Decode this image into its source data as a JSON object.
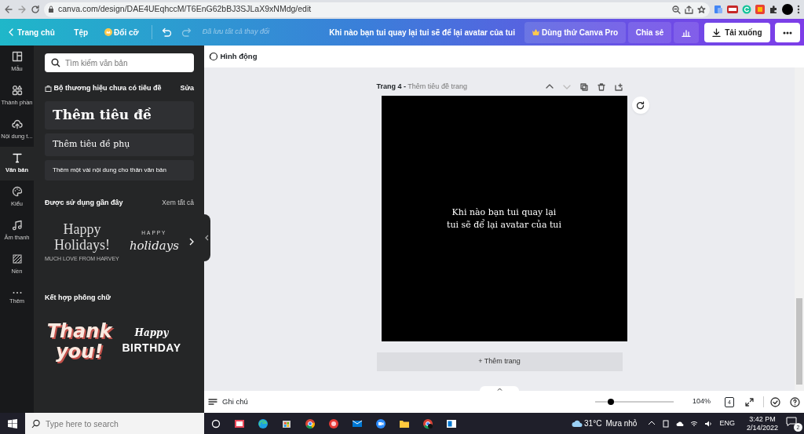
{
  "browser": {
    "url": "canva.com/design/DAE4UEqhccM/T6EnG62bBJ3SJLaX9xNMdg/edit"
  },
  "toolbar": {
    "home": "Trang chủ",
    "file": "Tệp",
    "resize": "Đổi cỡ",
    "saved_status": "Đã lưu tất cả thay đổi",
    "design_title": "Khi nào bạn tui quay lại tui sẽ để lại avatar của tui",
    "pro_button": "Dùng thử Canva Pro",
    "share_button": "Chia sẻ",
    "download_button": "Tải xuống"
  },
  "rail": {
    "items": [
      {
        "kind": "template",
        "label": "Mẫu",
        "selected": false
      },
      {
        "kind": "elements",
        "label": "Thành phần",
        "selected": false
      },
      {
        "kind": "upload",
        "label": "Nội dung t...",
        "selected": false
      },
      {
        "kind": "text",
        "label": "Văn bản",
        "selected": true
      },
      {
        "kind": "style",
        "label": "Kiểu",
        "selected": false
      },
      {
        "kind": "audio",
        "label": "Âm thanh",
        "selected": false
      },
      {
        "kind": "background",
        "label": "Nền",
        "selected": false
      },
      {
        "kind": "more",
        "label": "Thêm",
        "selected": false
      }
    ]
  },
  "panel": {
    "search": {
      "placeholder": "Tìm kiếm văn bản"
    },
    "brand_kit": {
      "title": "Bộ thương hiệu chưa có tiêu đề",
      "edit": "Sửa"
    },
    "text_styles": [
      {
        "kind": "heading",
        "label": "Thêm tiêu đề"
      },
      {
        "kind": "subheading",
        "label": "Thêm tiêu đề phụ"
      },
      {
        "kind": "body",
        "label": "Thêm một vài nội dung cho thân văn bản"
      }
    ],
    "recent": {
      "title": "Được sử dụng gần đây",
      "see_all": "Xem tất cả",
      "templates": [
        {
          "kind": "serif",
          "lines": [
            "Happy",
            "Holidays!",
            "MUCH LOVE FROM HARVEY"
          ]
        },
        {
          "kind": "script",
          "lines": [
            "HAPPY",
            "holidays"
          ]
        }
      ]
    },
    "font_combos": {
      "title": "Kết hợp phông chữ",
      "templates": [
        {
          "kind": "thank",
          "lines": [
            "Thank",
            "you!"
          ]
        },
        {
          "kind": "birthday",
          "lines": [
            "Happy",
            "BIRTHDAY"
          ]
        }
      ]
    }
  },
  "editor": {
    "animate": "Hình động",
    "page_label": "Trang 4 -",
    "page_title": "Thêm tiêu đề trang",
    "canvas_text": "Khi nào bạn tui quay lại tui sẽ để lại avatar của tui",
    "add_page": "+ Thêm trang",
    "notes": "Ghi chú",
    "zoom": {
      "level": 0.2,
      "reading": "104%"
    },
    "page_count": "4"
  },
  "taskbar": {
    "search": {
      "placeholder": "Type here to search"
    },
    "temperature": "31°C",
    "weather": "Mưa nhỏ",
    "language": "ENG",
    "time": "3:42 PM",
    "date": "2/14/2022",
    "notifications": "2"
  }
}
